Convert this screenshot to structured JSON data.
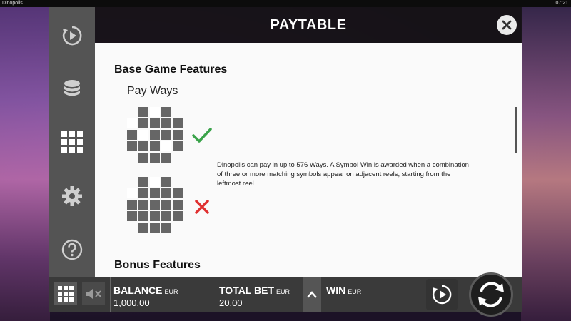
{
  "window": {
    "app_name": "Dinopolis",
    "clock": "07:21"
  },
  "sidebar": {
    "items": [
      {
        "icon": "replay-icon"
      },
      {
        "icon": "coins-icon"
      },
      {
        "icon": "grid-menu-icon"
      },
      {
        "icon": "gear-icon"
      },
      {
        "icon": "help-icon"
      }
    ]
  },
  "paytable": {
    "title": "PAYTABLE",
    "section_base": "Base Game Features",
    "subheading": "Pay Ways",
    "description": "Dinopolis can pay in up to 576 Ways. A Symbol Win is awarded when a combination of three or more matching symbols appear on adjacent reels, starting from the leftmost reel.",
    "section_bonus": "Bonus Features",
    "examples": [
      {
        "result": "valid",
        "icon": "checkmark-icon",
        "color": "#3aa34a"
      },
      {
        "result": "invalid",
        "icon": "cross-icon",
        "color": "#e03030"
      }
    ]
  },
  "bottombar": {
    "balance": {
      "label": "BALANCE",
      "currency": "EUR",
      "value": "1,000.00"
    },
    "total_bet": {
      "label": "TOTAL BET",
      "currency": "EUR",
      "value": "20.00"
    },
    "win": {
      "label": "WIN",
      "currency": "EUR",
      "value": ""
    }
  }
}
